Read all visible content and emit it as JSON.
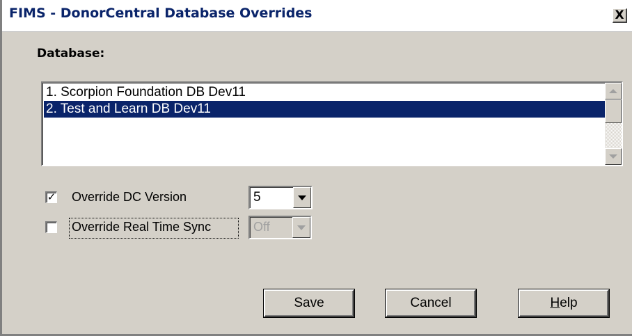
{
  "window": {
    "title": "FIMS - DonorCentral Database Overrides",
    "close_glyph": "X"
  },
  "database": {
    "label": "Database:",
    "items": [
      {
        "label": "1. Scorpion Foundation DB Dev11",
        "selected": false
      },
      {
        "label": "2. Test and Learn DB Dev11",
        "selected": true
      }
    ]
  },
  "options": {
    "override_dc_version": {
      "label": "Override DC Version",
      "checked": true,
      "check_glyph": "✓",
      "value": "5"
    },
    "override_real_time_sync": {
      "label": "Override Real Time Sync",
      "checked": false,
      "check_glyph": "",
      "value": "Off",
      "disabled": true
    }
  },
  "buttons": {
    "save": "Save",
    "cancel": "Cancel",
    "help_accel": "H",
    "help_rest": "elp"
  },
  "colors": {
    "face": "#d4d0c8",
    "title_text": "#0a246a",
    "selection": "#0a246a",
    "disabled_text": "#a0a0a0"
  },
  "icons": {
    "close": "close-icon",
    "scroll_up": "arrow-up-icon",
    "scroll_down": "arrow-down-icon",
    "dropdown": "chevron-down-icon"
  }
}
